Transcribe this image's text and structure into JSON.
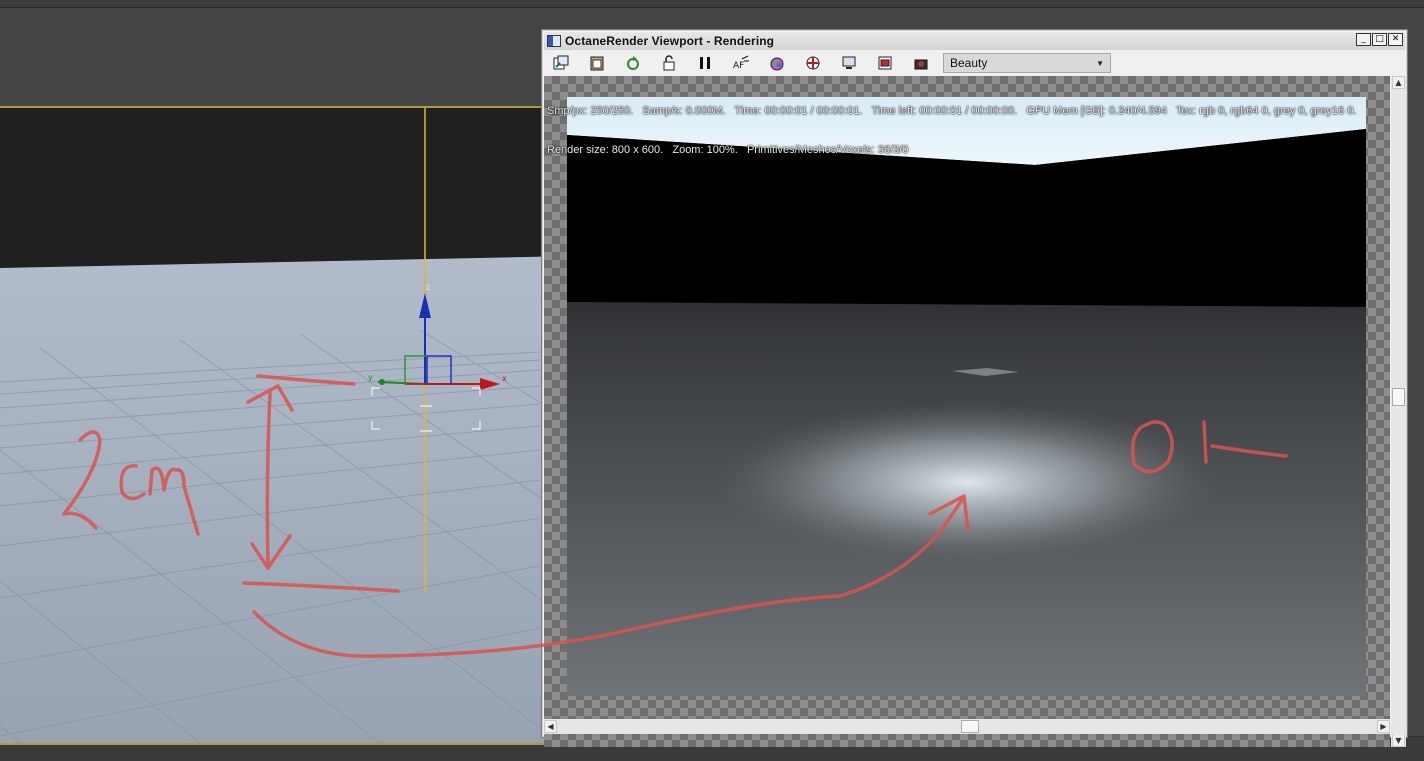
{
  "octane_window": {
    "title": "OctaneRender Viewport - Rendering",
    "controls": {
      "minimize": "_",
      "maximize": "□",
      "close": "✕"
    },
    "toolbar": {
      "buttons": [
        {
          "icon": "open-icon"
        },
        {
          "icon": "copy-to-clipboard-icon"
        },
        {
          "icon": "restart-render-icon"
        },
        {
          "icon": "lock-icon"
        },
        {
          "icon": "pause-icon"
        },
        {
          "icon": "autofocus-icon"
        },
        {
          "icon": "color-picker-icon"
        },
        {
          "icon": "region-render-icon"
        },
        {
          "icon": "display-icon"
        },
        {
          "icon": "film-settings-icon"
        },
        {
          "icon": "camera-icon"
        }
      ],
      "render_pass": {
        "selected": "Beauty"
      }
    },
    "stats": {
      "line1": "Smp/px: 250/250.   Samp/s: 0.000M.   Time: 00:00:01 / 00:00:01.   Time left: 00:00:01 / 00:00:00.   GPU Mem [GB]: 0.340/4.594   Tex: rgb 0, rgb64 0, grey 0, grey16 0.",
      "line2": "Render size: 800 x 600.   Zoom: 100%.   Primitives/Meshes/Voxels: 36/3/0"
    }
  },
  "annotations": {
    "left_note": "2cm",
    "right_note": "Ok",
    "color": "#d9534f"
  },
  "colors": {
    "viewport_border": "#b49a3c",
    "grid_floor": "#a4b0c0",
    "render_floor": "#6f7478"
  }
}
